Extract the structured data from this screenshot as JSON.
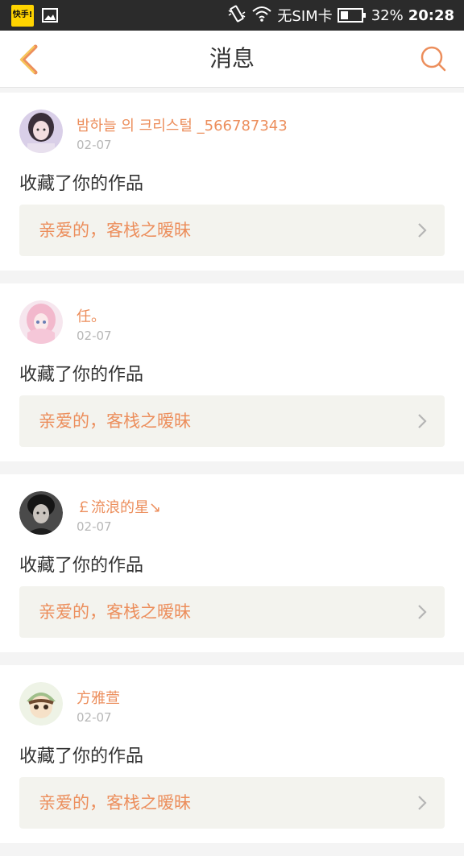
{
  "status_bar": {
    "app_badge": "快手!",
    "sim_text": "无SIM卡",
    "battery_percent": "32%",
    "time": "20:28",
    "icons": [
      "image-icon",
      "vibrate-icon",
      "wifi-icon",
      "battery-icon"
    ]
  },
  "header": {
    "title": "消息",
    "accent_color": "#ec8e5c"
  },
  "messages": [
    {
      "name": "밤하늘 의 크리스털 _566787343",
      "date": "02-07",
      "action": "收藏了你的作品",
      "work": "亲爱的，客栈之暧昧"
    },
    {
      "name": "任。",
      "date": "02-07",
      "action": "收藏了你的作品",
      "work": "亲爱的，客栈之暧昧"
    },
    {
      "name": "￡流浪的星↘",
      "date": "02-07",
      "action": "收藏了你的作品",
      "work": "亲爱的，客栈之暧昧"
    },
    {
      "name": "方雅萱",
      "date": "02-07",
      "action": "收藏了你的作品",
      "work": "亲爱的，客栈之暧昧"
    }
  ]
}
